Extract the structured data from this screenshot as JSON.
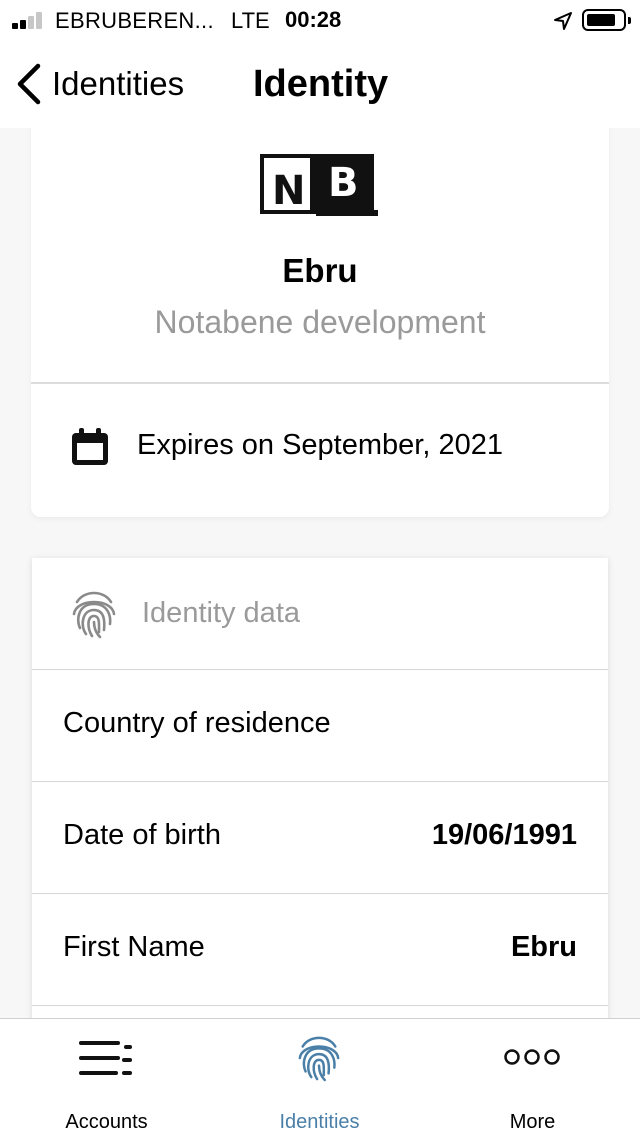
{
  "status_bar": {
    "carrier": "EBRUBEREN...",
    "network": "LTE",
    "time": "00:28",
    "signal_bars_filled": 2,
    "signal_bars_total": 4
  },
  "nav": {
    "back_label": "Identities",
    "title": "Identity"
  },
  "identity_card": {
    "logo_text": "NB",
    "name": "Ebru",
    "organization": "Notabene development",
    "expires": "Expires on September, 2021"
  },
  "identity_data": {
    "header": "Identity data",
    "rows": [
      {
        "label": "Country of residence",
        "value": ""
      },
      {
        "label": "Date of birth",
        "value": "19/06/1991"
      },
      {
        "label": "First Name",
        "value": "Ebru"
      }
    ]
  },
  "tabs": [
    {
      "label": "Accounts",
      "icon": "accounts-list-icon",
      "active": false
    },
    {
      "label": "Identities",
      "icon": "fingerprint-icon",
      "active": true
    },
    {
      "label": "More",
      "icon": "more-dots-icon",
      "active": false
    }
  ],
  "colors": {
    "accent": "#4a7fa8",
    "muted_text": "#9a9a9a",
    "background": "#f7f7f7"
  }
}
